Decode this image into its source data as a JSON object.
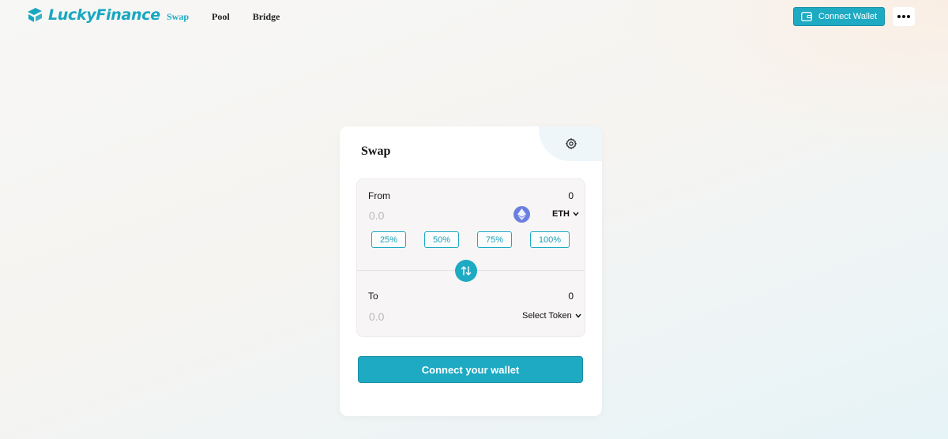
{
  "header": {
    "brand": "LuckyFinance",
    "nav": [
      {
        "label": "Swap",
        "active": true
      },
      {
        "label": "Pool",
        "active": false
      },
      {
        "label": "Bridge",
        "active": false
      }
    ],
    "connect_wallet_label": "Connect Wallet",
    "more_icon": "ellipsis-icon"
  },
  "swap": {
    "title": "Swap",
    "settings_icon": "gear-icon",
    "from": {
      "label": "From",
      "balance": "0",
      "amount_placeholder": "0.0",
      "token_icon": "ethereum-icon",
      "token": "ETH",
      "percent_buttons": [
        "25%",
        "50%",
        "75%",
        "100%"
      ]
    },
    "switch_icon": "swap-arrows-icon",
    "to": {
      "label": "To",
      "balance": "0",
      "amount_placeholder": "0.0",
      "token": "Select Token"
    },
    "cta_label": "Connect your wallet"
  },
  "colors": {
    "accent": "#1eaac3",
    "eth": "#6a7fe0"
  }
}
